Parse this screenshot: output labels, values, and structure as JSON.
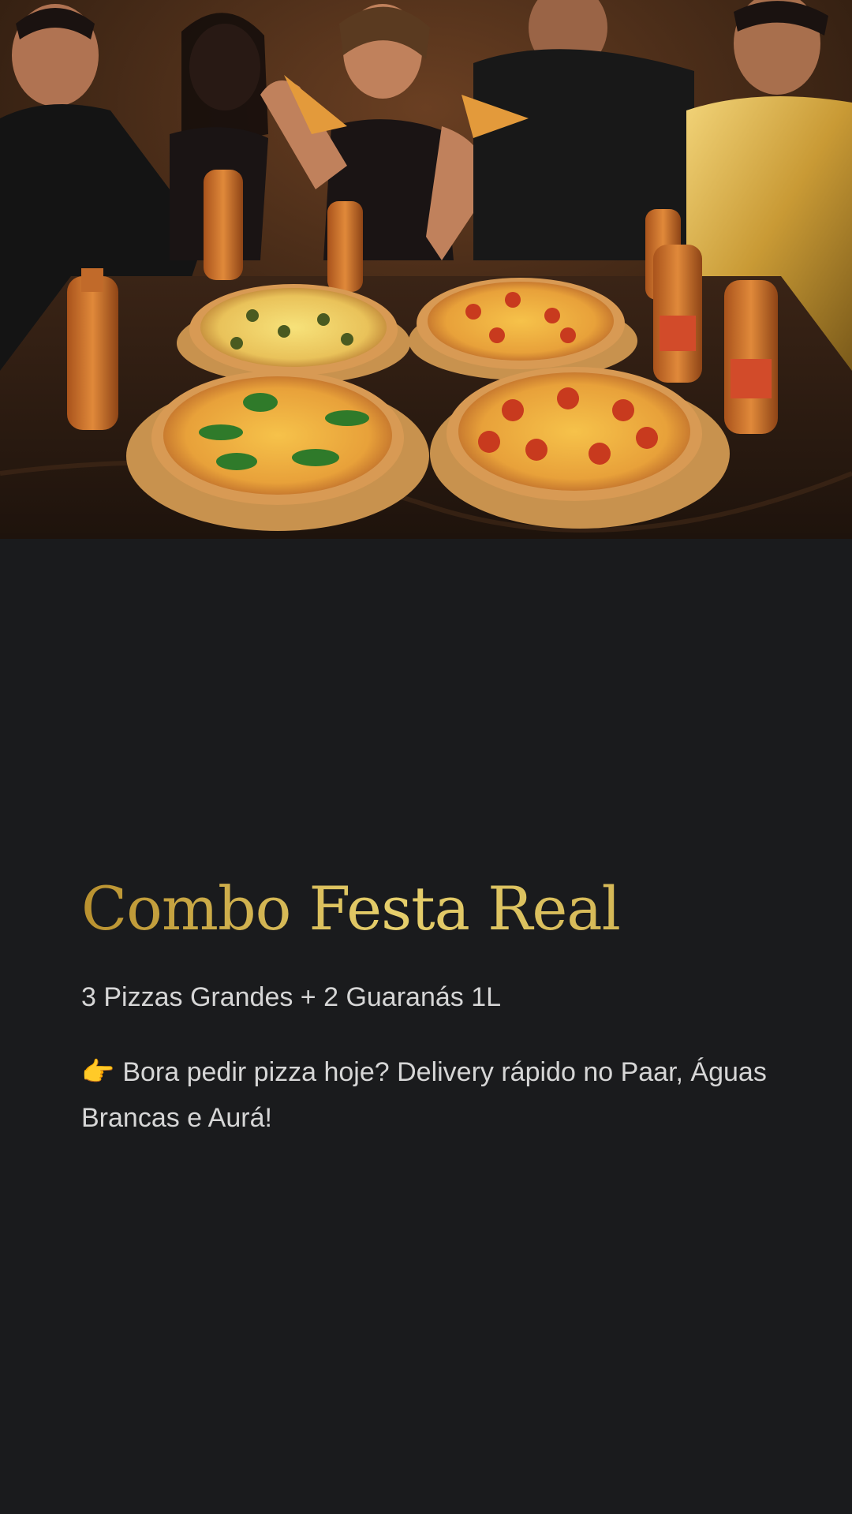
{
  "hero": {
    "image_alt": "Grupo de amigos comendo pizzas em uma mesa com garrafas de guaraná"
  },
  "offer": {
    "title": "Combo Festa Real",
    "subtitle": "3 Pizzas Grandes + 2 Guaranás 1L",
    "pointer_emoji": "👉",
    "description": "Bora pedir pizza hoje? Delivery rápido no Paar, Águas Brancas e Aurá!"
  },
  "colors": {
    "background": "#1a1b1d",
    "title_gold": "#d8bb55",
    "body_text": "#d6d6d6"
  }
}
